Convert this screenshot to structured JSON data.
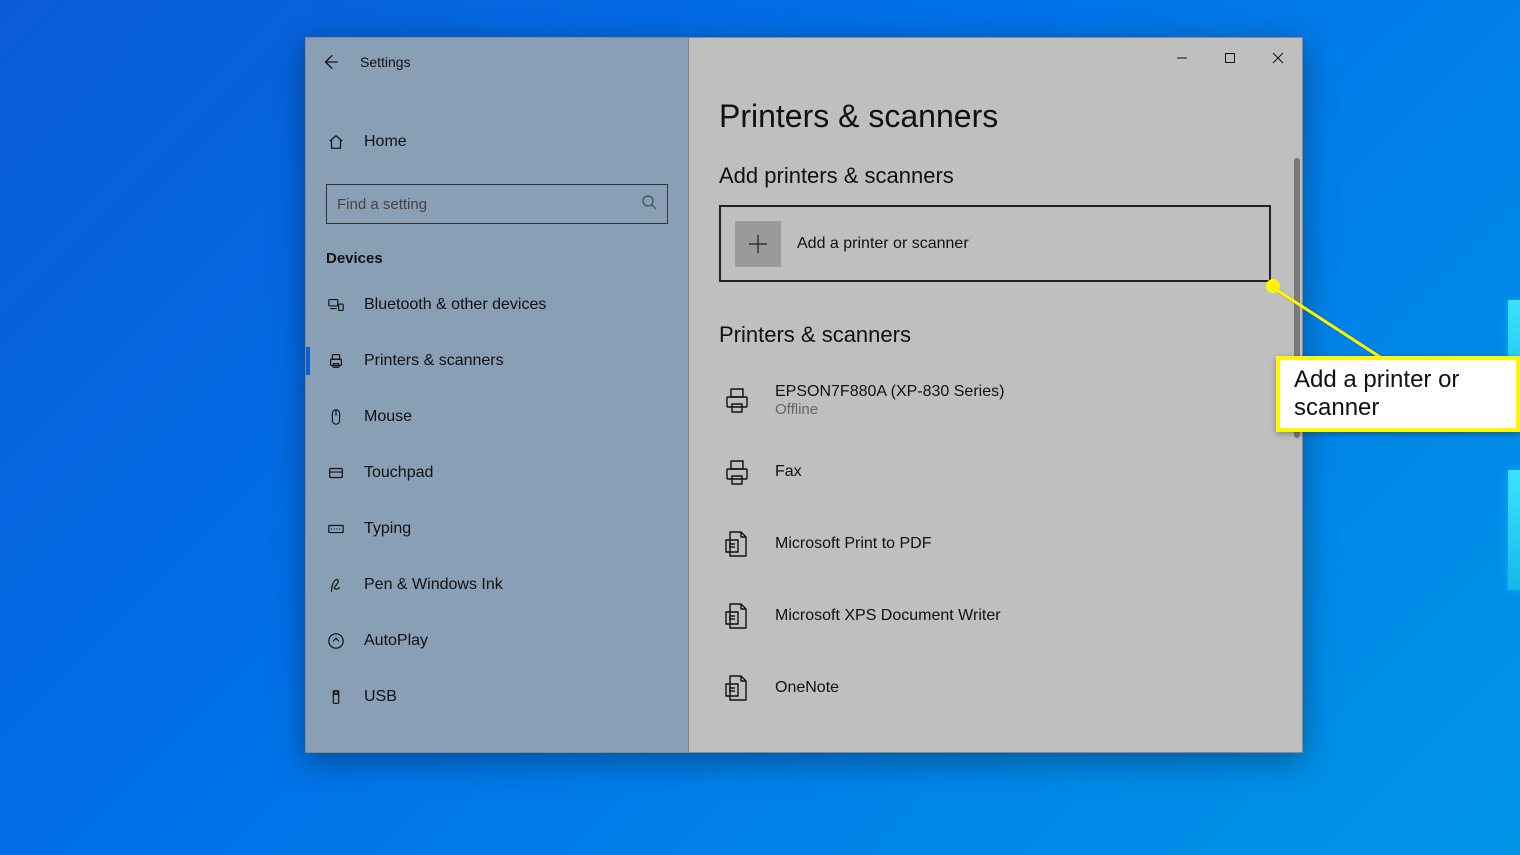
{
  "window": {
    "title": "Settings"
  },
  "sidebar": {
    "home_label": "Home",
    "search_placeholder": "Find a setting",
    "section_label": "Devices",
    "items": [
      {
        "label": "Bluetooth & other devices",
        "selected": false
      },
      {
        "label": "Printers & scanners",
        "selected": true
      },
      {
        "label": "Mouse",
        "selected": false
      },
      {
        "label": "Touchpad",
        "selected": false
      },
      {
        "label": "Typing",
        "selected": false
      },
      {
        "label": "Pen & Windows Ink",
        "selected": false
      },
      {
        "label": "AutoPlay",
        "selected": false
      },
      {
        "label": "USB",
        "selected": false
      }
    ]
  },
  "content": {
    "page_title": "Printers & scanners",
    "add_section_title": "Add printers & scanners",
    "add_button_label": "Add a printer or scanner",
    "list_section_title": "Printers & scanners",
    "printers": [
      {
        "name": "EPSON7F880A (XP-830 Series)",
        "status": "Offline",
        "icon": "printer"
      },
      {
        "name": "Fax",
        "status": "",
        "icon": "printer"
      },
      {
        "name": "Microsoft Print to PDF",
        "status": "",
        "icon": "document"
      },
      {
        "name": "Microsoft XPS Document Writer",
        "status": "",
        "icon": "document"
      },
      {
        "name": "OneNote",
        "status": "",
        "icon": "document"
      }
    ]
  },
  "annotation": {
    "callout_text": "Add a printer or scanner"
  }
}
